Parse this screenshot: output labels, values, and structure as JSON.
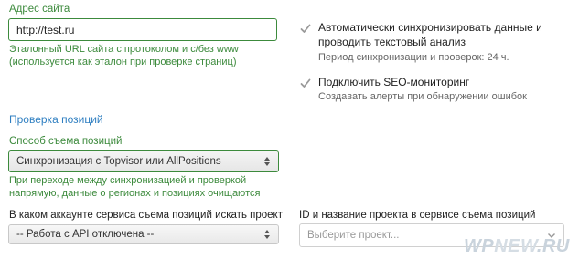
{
  "site": {
    "label": "Адрес сайта",
    "url_value": "http://test.ru",
    "help": "Эталонный URL сайта с протоколом и с/без www (используется как эталон при проверке страниц)"
  },
  "sync_option": {
    "checked": true,
    "label": "Автоматически синхронизировать данные и проводить текстовый анализ",
    "note": "Период синхронизации и проверок: 24 ч."
  },
  "seo_option": {
    "checked": true,
    "label": "Подключить SEO-мониторинг",
    "note": "Создавать алерты при обнаружении ошибок"
  },
  "positions": {
    "section_title": "Проверка позиций",
    "method_label": "Способ съема позиций",
    "method_value": "Синхронизация с Topvisor или AllPositions",
    "method_help": "При переходе между синхронизацией и проверкой напрямую, данные о регионах и позициях очищаются",
    "account_label": "В каком аккаунте сервиса съема позиций искать проект",
    "account_value": "-- Работа с API отключена --",
    "project_label": "ID и название проекта в сервисе съема позиций",
    "project_placeholder": "Выберите проект..."
  },
  "watermark": {
    "prefix": "WP",
    "middle": "NEW",
    "suffix": ".RU"
  },
  "colors": {
    "label_green": "#3c8a3c",
    "section_blue": "#2f7fc1",
    "check_gray": "#9a9a9a"
  }
}
